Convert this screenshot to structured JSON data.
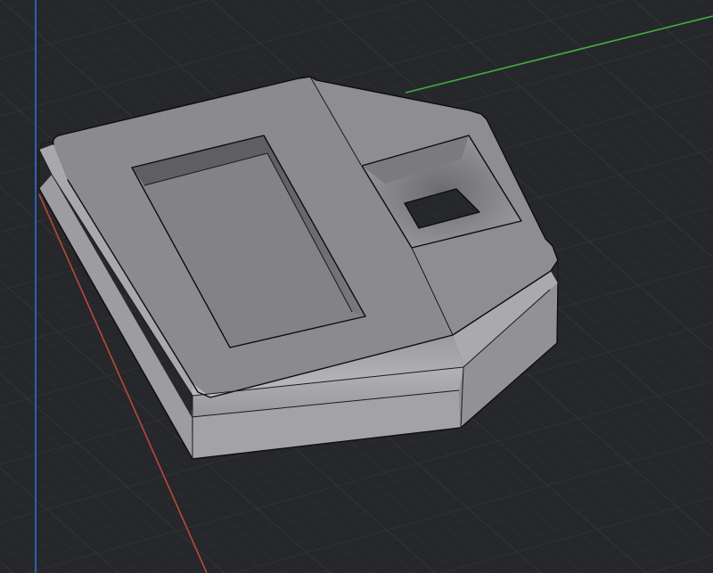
{
  "viewport": {
    "background_color": "#26272a",
    "grid_color": "#3a3b3f",
    "grid_minor_color": "#303135"
  },
  "axes": {
    "x_color": "#b84a3a",
    "y_color": "#3fae49",
    "z_color": "#2e6fd1"
  },
  "model": {
    "body_color": "#8f8f93",
    "top_face_color": "#8b8b8f",
    "side_face_color": "#a6a6aa",
    "pocket_floor_color": "#818185",
    "pocket_wall_color": "#6a6a6e",
    "edge_color": "#0d0d0d"
  }
}
